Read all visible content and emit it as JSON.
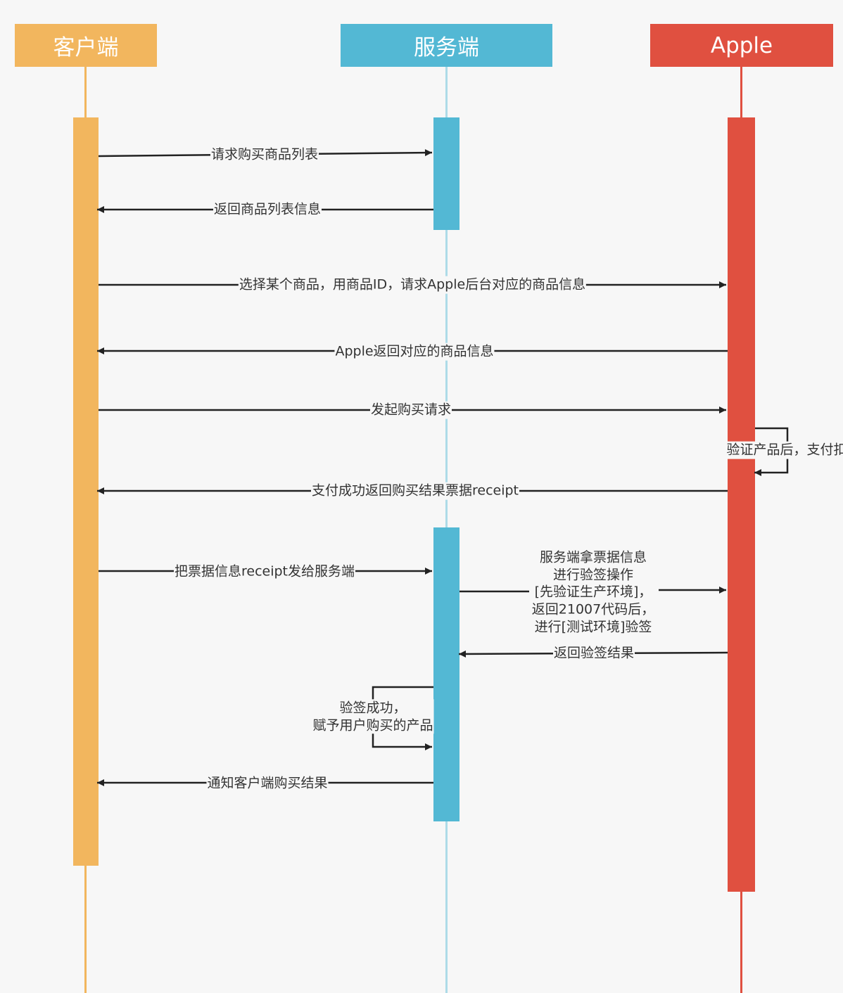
{
  "participants": {
    "client": {
      "label": "客户端",
      "color": "#f2b65e"
    },
    "server": {
      "label": "服务端",
      "color": "#53b8d4"
    },
    "apple": {
      "label": "Apple",
      "color": "#e05040"
    }
  },
  "messages": [
    {
      "id": "m1",
      "text": "请求购买商品列表"
    },
    {
      "id": "m2",
      "text": "返回商品列表信息"
    },
    {
      "id": "m3",
      "text": "选择某个商品，用商品ID，请求Apple后台对应的商品信息"
    },
    {
      "id": "m4",
      "text": "Apple返回对应的商品信息"
    },
    {
      "id": "m5",
      "text": "发起购买请求"
    },
    {
      "id": "m6",
      "text": "验证产品后，支付扣"
    },
    {
      "id": "m7",
      "text": "支付成功返回购买结果票据receipt"
    },
    {
      "id": "m8",
      "text": "把票据信息receipt发给服务端"
    },
    {
      "id": "m9",
      "lines": [
        "服务端拿票据信息",
        "进行验签操作",
        "[先验证生产环境]，",
        "返回21007代码后，",
        "进行[测试环境]验签"
      ]
    },
    {
      "id": "m10",
      "text": "返回验签结果"
    },
    {
      "id": "m11",
      "lines": [
        "验签成功，",
        "赋予用户购买的产品"
      ]
    },
    {
      "id": "m12",
      "text": "通知客户端购买结果"
    }
  ]
}
